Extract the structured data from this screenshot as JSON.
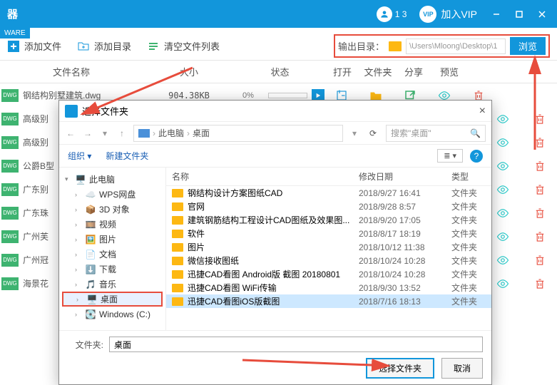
{
  "titlebar": {
    "app_suffix": "器",
    "ware": "WARE",
    "user": "1             3",
    "vip_badge": "VIP",
    "vip_link": "加入VIP"
  },
  "toolbar": {
    "add_file": "添加文件",
    "add_dir": "添加目录",
    "clear": "清空文件列表",
    "output_label": "输出目录：",
    "output_path": "\\Users\\Mloong\\Desktop\\1",
    "browse": "浏览"
  },
  "columns": {
    "name": "文件名称",
    "size": "大小",
    "status": "状态",
    "open": "打开",
    "folder": "文件夹",
    "share": "分享",
    "preview": "预览"
  },
  "files": [
    {
      "name": "钢结构别墅建筑.dwg",
      "size": "904.38KB",
      "pct": "0%"
    },
    {
      "name": "高级别"
    },
    {
      "name": "高级别"
    },
    {
      "name": "公爵B型"
    },
    {
      "name": "广东别"
    },
    {
      "name": "广东珠"
    },
    {
      "name": "广州芙"
    },
    {
      "name": "广州冠"
    },
    {
      "name": "海景花"
    }
  ],
  "dialog": {
    "title": "选择文件夹",
    "breadcrumb": {
      "pc": "此电脑",
      "desktop": "桌面"
    },
    "search_placeholder": "搜索\"桌面\"",
    "toolbar": {
      "organize": "组织",
      "new_folder": "新建文件夹"
    },
    "tree": [
      {
        "label": "此电脑",
        "icon": "pc",
        "level": 0,
        "expanded": true
      },
      {
        "label": "WPS网盘",
        "icon": "wps",
        "level": 1
      },
      {
        "label": "3D 对象",
        "icon": "3d",
        "level": 1
      },
      {
        "label": "视频",
        "icon": "video",
        "level": 1
      },
      {
        "label": "图片",
        "icon": "image",
        "level": 1
      },
      {
        "label": "文档",
        "icon": "doc",
        "level": 1
      },
      {
        "label": "下载",
        "icon": "download",
        "level": 1
      },
      {
        "label": "音乐",
        "icon": "music",
        "level": 1
      },
      {
        "label": "桌面",
        "icon": "desktop",
        "level": 1,
        "selected": true
      },
      {
        "label": "Windows (C:)",
        "icon": "disk",
        "level": 1
      }
    ],
    "list_columns": {
      "name": "名称",
      "date": "修改日期",
      "type": "类型"
    },
    "list": [
      {
        "name": "钢结构设计方案图纸CAD",
        "date": "2018/9/27 16:41",
        "type": "文件夹"
      },
      {
        "name": "官网",
        "date": "2018/9/28 8:57",
        "type": "文件夹"
      },
      {
        "name": "建筑钢筋结构工程设计CAD图纸及效果图...",
        "date": "2018/9/20 17:05",
        "type": "文件夹"
      },
      {
        "name": "软件",
        "date": "2018/8/17 18:19",
        "type": "文件夹"
      },
      {
        "name": "图片",
        "date": "2018/10/12 11:38",
        "type": "文件夹"
      },
      {
        "name": "微信接收图纸",
        "date": "2018/10/24 10:28",
        "type": "文件夹"
      },
      {
        "name": "迅捷CAD看图 Android版 截图 20180801",
        "date": "2018/10/24 10:28",
        "type": "文件夹"
      },
      {
        "name": "迅捷CAD看图 WiFi传输",
        "date": "2018/9/30 13:52",
        "type": "文件夹"
      },
      {
        "name": "迅捷CAD看图iOS版截图",
        "date": "2018/7/16 18:13",
        "type": "文件夹",
        "selected": true
      }
    ],
    "folder_label": "文件夹:",
    "folder_value": "桌面",
    "ok": "选择文件夹",
    "cancel": "取消"
  }
}
